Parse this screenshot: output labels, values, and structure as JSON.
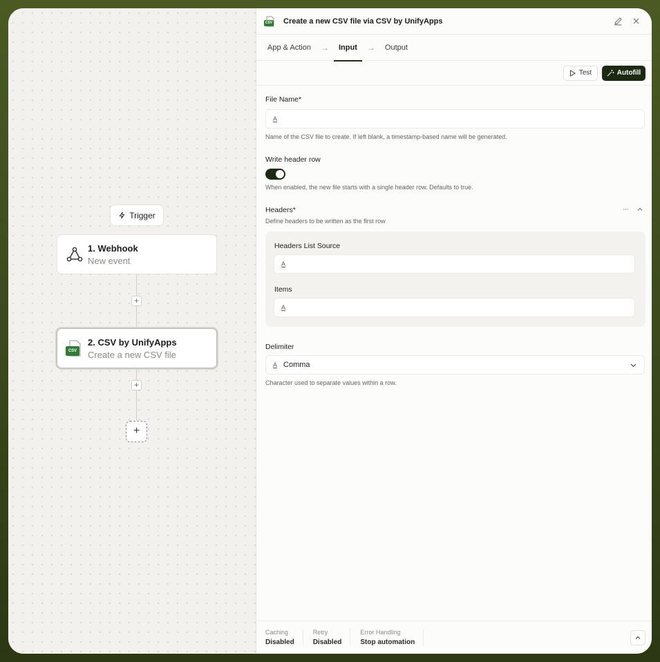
{
  "canvas": {
    "trigger_label": "Trigger",
    "nodes": [
      {
        "title": "1. Webhook",
        "subtitle": "New event"
      },
      {
        "title": "2. CSV by UnifyApps",
        "subtitle": "Create a new CSV file"
      }
    ],
    "add_step_symbol": "+",
    "csv_badge": "CSV"
  },
  "panel": {
    "title": "Create a new CSV file via CSV by UnifyApps",
    "tabs": [
      "App & Action",
      "Input",
      "Output"
    ],
    "active_tab": "Input",
    "tab_arrow": "→",
    "test_label": "Test",
    "autofill_label": "Autofill"
  },
  "form": {
    "file_name": {
      "label": "File Name*",
      "value": "",
      "hint": "Name of the CSV file to create. If left blank, a timestamp-based name will be generated."
    },
    "write_header_row": {
      "label": "Write header row",
      "enabled": true,
      "hint": "When enabled, the new file starts with a single header row. Defaults to true."
    },
    "headers": {
      "label": "Headers*",
      "hint": "Define headers to be written as the first row",
      "more_symbol": "···",
      "list_source_label": "Headers List Source",
      "items_label": "Items"
    },
    "delimiter": {
      "label": "Delimiter",
      "value": "Comma",
      "hint": "Character used to separate values within a row."
    },
    "text_type_glyph": "A"
  },
  "footer": {
    "caching": {
      "key": "Caching",
      "value": "Disabled"
    },
    "retry": {
      "key": "Retry",
      "value": "Disabled"
    },
    "error_handling": {
      "key": "Error Handling",
      "value": "Stop automation"
    }
  },
  "colors": {
    "accent": "#1b2a10",
    "frame": "#3c4a1c",
    "csv_green": "#2e7d32"
  }
}
